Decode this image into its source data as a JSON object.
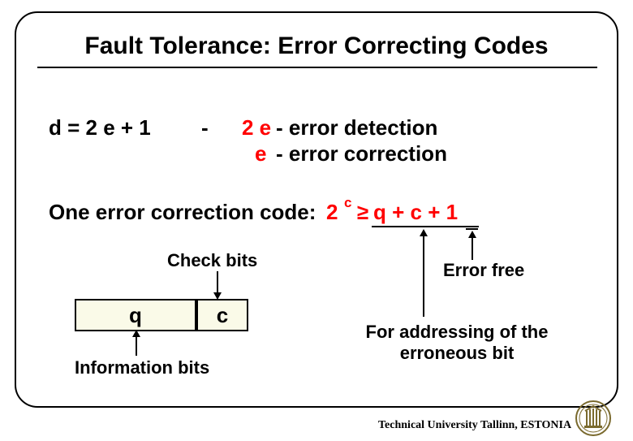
{
  "title": "Fault Tolerance: Error Correcting Codes",
  "line1": {
    "formula": "d = 2 e + 1",
    "dash": "-",
    "detect_e": "2 e",
    "detect_rest": " - error detection",
    "correct_e": " e",
    "correct_rest": " - error correction"
  },
  "line2": {
    "label": "One error correction code:",
    "two": "2",
    "sup": "c",
    "ge": "≥",
    "rhs": "q + c + 1"
  },
  "labels": {
    "check_bits": "Check bits",
    "info_bits": "Information bits",
    "error_free": "Error free",
    "for_addressing": "For addressing of the erroneous bit"
  },
  "boxes": {
    "q": "q",
    "c": "c"
  },
  "footer": "Technical University Tallinn, ESTONIA"
}
